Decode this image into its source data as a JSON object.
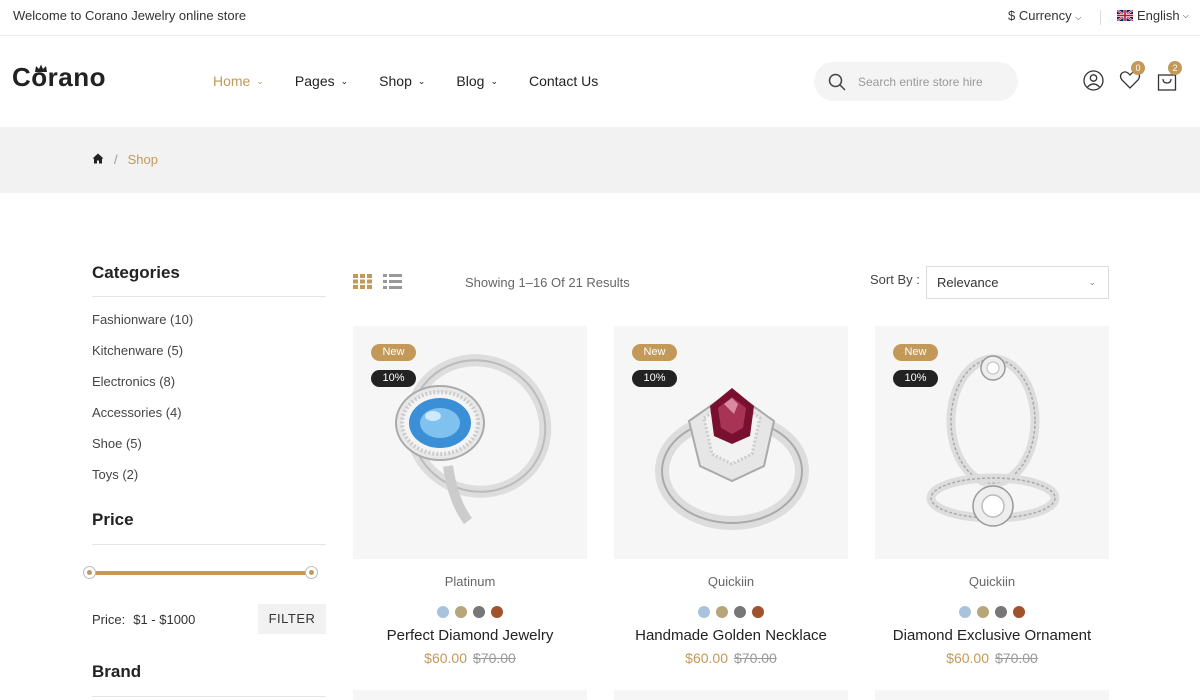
{
  "topbar": {
    "welcome": "Welcome to Corano Jewelry online store",
    "currency_label": "$ Currency",
    "language_label": "English"
  },
  "header": {
    "logo": "Corano",
    "nav": [
      {
        "label": "Home",
        "active": true
      },
      {
        "label": "Pages",
        "active": false
      },
      {
        "label": "Shop",
        "active": false
      },
      {
        "label": "Blog",
        "active": false
      },
      {
        "label": "Contact Us",
        "active": false
      }
    ],
    "search_placeholder": "Search entire store hire",
    "wishlist_count": "0",
    "cart_count": "2"
  },
  "breadcrumb": {
    "current": "Shop"
  },
  "sidebar": {
    "categories_title": "Categories",
    "categories": [
      "Fashionware (10)",
      "Kitchenware (5)",
      "Electronics (8)",
      "Accessories (4)",
      "Shoe (5)",
      "Toys (2)"
    ],
    "price_title": "Price",
    "price_label": "Price:",
    "price_range": "$1 - $1000",
    "filter_button": "FILTER",
    "brand_title": "Brand"
  },
  "toolbar": {
    "showing": "Showing 1–16 Of 21 Results",
    "sort_label": "Sort By :",
    "sort_value": "Relevance"
  },
  "products": [
    {
      "tag_new": "New",
      "tag_discount": "10%",
      "brand": "Platinum",
      "name": "Perfect Diamond Jewelry",
      "price": "$60.00",
      "old_price": "$70.00",
      "gem": "blue"
    },
    {
      "tag_new": "New",
      "tag_discount": "10%",
      "brand": "Quickiin",
      "name": "Handmade Golden Necklace",
      "price": "$60.00",
      "old_price": "$70.00",
      "gem": "ruby"
    },
    {
      "tag_new": "New",
      "tag_discount": "10%",
      "brand": "Quickiin",
      "name": "Diamond Exclusive Ornament",
      "price": "$60.00",
      "old_price": "$70.00",
      "gem": "diamond"
    }
  ],
  "swatch_colors": [
    "#a9c3dd",
    "#b8a57a",
    "#777777",
    "#a0522d"
  ],
  "colors": {
    "accent": "#c29958",
    "dark_badge": "#222222",
    "band": "#f2f2f2"
  }
}
